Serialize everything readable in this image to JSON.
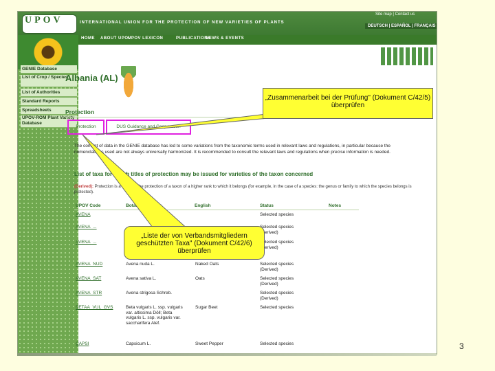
{
  "header": {
    "logo": "UPOV",
    "union_text": "INTERNATIONAL UNION FOR THE PROTECTION OF NEW VARIETIES OF PLANTS",
    "top_links": "Site map | Contact us",
    "languages": "DEUTSCH | ESPAÑOL | FRANÇAIS"
  },
  "nav": [
    "HOME",
    "ABOUT UPOV",
    "UPOV LEXICON",
    "PUBLICATIONS",
    "NEWS & EVENTS"
  ],
  "sidebar": {
    "items": [
      {
        "label": "GENIE Database"
      },
      {
        "label": "List of Crop / Species"
      },
      {
        "label": "List of Authorities"
      },
      {
        "label": "Standard Reports"
      },
      {
        "label": "Spreadsheets"
      },
      {
        "label": "UPOV-ROM Plant Variety Database"
      }
    ]
  },
  "page": {
    "title": "Albania (AL)",
    "section": "Protection",
    "tabs": [
      "Protection",
      "DUS Guidance and Cooperation"
    ],
    "paragraph": "The content of data in the GENIE database has led to some variations from the taxonomic terms used in relevant laws and regulations, in particular because the nomenclatures used are not always universally harmonized. It is recommended to consult the relevant laws and regulations when precise information is needed.",
    "list_title": "List of taxa for which titles of protection may be issued for varieties of the taxon concerned",
    "derived_label": "(Derived):",
    "derived_text": "Protection is a result of the protection of a taxon of a higher rank to which it belongs (for example, in the case of a species: the genus or family to which the species belongs is protected)."
  },
  "table": {
    "headers": [
      "UPOV Code",
      "Botanical Names",
      "English",
      "Status",
      "Notes"
    ],
    "rows": [
      {
        "code": "AVENA",
        "botanical": "",
        "english": "",
        "status": "Selected species"
      },
      {
        "code": "AVENA_...",
        "botanical": "",
        "english": "",
        "status": "Selected species (Derived)"
      },
      {
        "code": "AVENA_...",
        "botanical": "",
        "english": "",
        "status": "Selected species (Derived)"
      },
      {
        "code": "AVENA_NUD",
        "botanical": "Avena nuda L.",
        "english": "Naked Oats",
        "status": "Selected species (Derived)"
      },
      {
        "code": "AVENA_SAT",
        "botanical": "Avena sativa L.",
        "english": "Oats",
        "status": "Selected species (Derived)"
      },
      {
        "code": "AVENA_STR",
        "botanical": "Avena strigosa Schreb.",
        "english": "",
        "status": "Selected species (Derived)"
      },
      {
        "code": "BETAA_VUL_GVS",
        "botanical": "Beta vulgaris L. ssp. vulgaris var. altissima Döll; Beta vulgaris L. ssp. vulgaris var. saccharifera Alef.",
        "english": "Sugar Beet",
        "status": "Selected species"
      },
      {
        "code": "CAPSI",
        "botanical": "Capsicum L.",
        "english": "Sweet Pepper",
        "status": "Selected species"
      }
    ]
  },
  "callouts": {
    "top": "„Zusammenarbeit bei der Prüfung\" (Dokument C/42/5) überprüfen",
    "bottom": "„Liste der von Verbandsmitgliedern geschützten Taxa\" (Dokument C/42/6) überprüfen"
  },
  "slide_number": "3",
  "colors": {
    "brand_green": "#3e7a32",
    "highlight_border": "#e020e0",
    "callout_fill": "#ffff33"
  }
}
